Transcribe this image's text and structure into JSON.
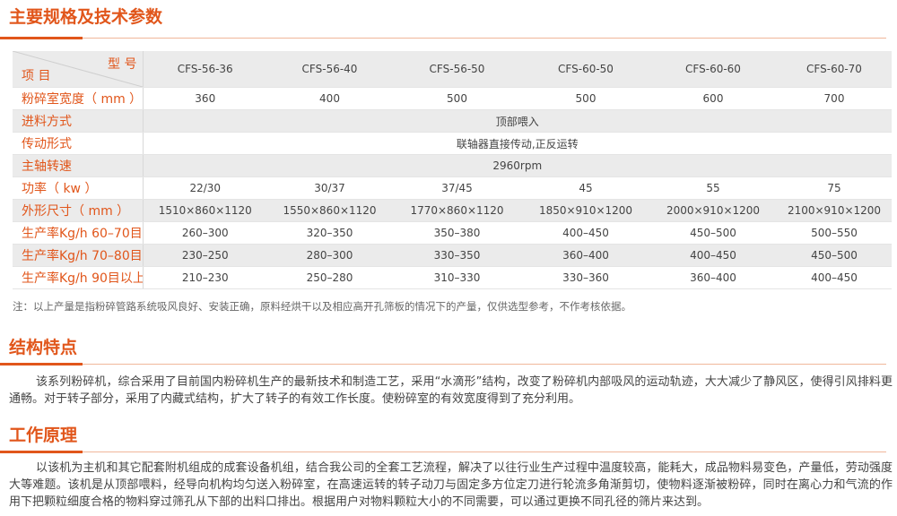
{
  "section1": {
    "title": "主要规格及技术参数"
  },
  "table": {
    "corner_top": "型 号",
    "corner_bottom": "项 目",
    "models": [
      "CFS-56-36",
      "CFS-56-40",
      "CFS-56-50",
      "CFS-60-50",
      "CFS-60-60",
      "CFS-60-70"
    ],
    "rows": [
      {
        "label": "粉碎室宽度（ mm ）",
        "values": [
          "360",
          "400",
          "500",
          "500",
          "600",
          "700"
        ]
      },
      {
        "label": "进料方式",
        "span": "顶部喂入"
      },
      {
        "label": "传动形式",
        "span": "联轴器直接传动,正反运转"
      },
      {
        "label": "主轴转速",
        "span": "2960rpm"
      },
      {
        "label": "功率（ kw ）",
        "values": [
          "22/30",
          "30/37",
          "37/45",
          "45",
          "55",
          "75"
        ]
      },
      {
        "label": "外形尺寸（ mm ）",
        "values": [
          "1510×860×1120",
          "1550×860×1120",
          "1770×860×1120",
          "1850×910×1200",
          "2000×910×1200",
          "2100×910×1200"
        ]
      },
      {
        "label": "生产率Kg/h 60–70目",
        "values": [
          "260–300",
          "320–350",
          "350–380",
          "400–450",
          "450–500",
          "500–550"
        ]
      },
      {
        "label": "生产率Kg/h 70–80目",
        "values": [
          "230–250",
          "280–300",
          "330–350",
          "360–400",
          "400–450",
          "450–500"
        ]
      },
      {
        "label": "生产率Kg/h 90目以上",
        "values": [
          "210–230",
          "250–280",
          "310–330",
          "330–360",
          "360–400",
          "400–450"
        ]
      }
    ]
  },
  "note": "注：以上产量是指粉碎管路系统吸风良好、安装正确，原料经烘干以及相应高开孔筛板的情况下的产量，仅供选型参考，不作考核依据。",
  "section2": {
    "title": "结构特点",
    "text": "该系列粉碎机，综合采用了目前国内粉碎机生产的最新技术和制造工艺，采用“水滴形”结构，改变了粉碎机内部吸风的运动轨迹，大大减少了静风区，使得引风排料更通畅。对于转子部分，采用了内藏式结构，扩大了转子的有效工作长度。使粉碎室的有效宽度得到了充分利用。"
  },
  "section3": {
    "title": "工作原理",
    "text": "以该机为主机和其它配套附机组成的成套设备机组，结合我公司的全套工艺流程，解决了以往行业生产过程中温度较高，能耗大，成品物料易变色，产量低，劳动强度大等难题。该机是从顶部喂料，经导向机构均匀送入粉碎室，在高速运转的转子动刀与固定多方位定刀进行轮流多角渐剪切，使物料逐渐被粉碎，同时在离心力和气流的作用下把颗粒细度合格的物料穿过筛孔从下部的出料口排出。根据用户对物料颗粒大小的不同需要，可以通过更换不同孔径的筛片来达到。"
  },
  "colors": {
    "accent": "#e1561b",
    "row_shade": "#ebebeb",
    "text": "#444444"
  }
}
